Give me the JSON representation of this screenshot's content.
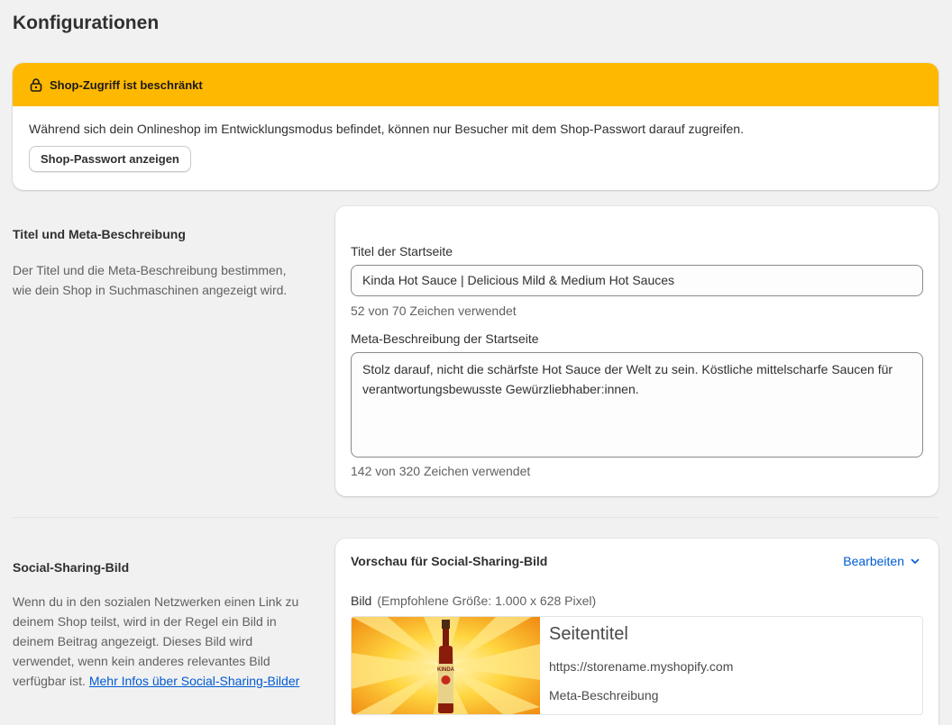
{
  "page": {
    "title": "Konfigurationen"
  },
  "banner": {
    "title": "Shop-Zugriff ist beschränkt",
    "text": "Während sich dein Onlineshop im Entwicklungsmodus befindet, können nur Besucher mit dem Shop-Passwort darauf zugreifen.",
    "button_label": "Shop-Passwort anzeigen",
    "color": "#ffb800"
  },
  "seo_section": {
    "title": "Titel und Meta-Beschreibung",
    "description": "Der Titel und die Meta-Beschreibung bestimmen, wie dein Shop in Suchmaschinen angezeigt wird.",
    "home_title": {
      "label": "Titel der Startseite",
      "value": "Kinda Hot Sauce | Delicious Mild & Medium Hot Sauces",
      "help": "52 von 70 Zeichen verwendet"
    },
    "home_meta": {
      "label": "Meta-Beschreibung der Startseite",
      "value": "Stolz darauf, nicht die schärfste Hot Sauce der Welt zu sein. Köstliche mittelscharfe Saucen für verantwortungsbewusste Gewürzliebhaber:innen.",
      "help": "142 von 320 Zeichen verwendet"
    }
  },
  "social_section": {
    "title": "Social-Sharing-Bild",
    "description": "Wenn du in den sozialen Netzwerken einen Link zu deinem Shop teilst, wird in der Regel ein Bild in deinem Beitrag angezeigt. Dieses Bild wird verwendet, wenn kein anderes relevantes Bild verfügbar ist.",
    "link_text": "Mehr Infos über Social-Sharing-Bilder",
    "card_title": "Vorschau für Social-Sharing-Bild",
    "edit_label": "Bearbeiten",
    "image_label": "Bild",
    "image_hint": "(Empfohlene Größe: 1.000 x 628 Pixel)",
    "preview": {
      "title": "Seitentitel",
      "url": "https://storename.myshopify.com",
      "description": "Meta-Beschreibung",
      "bottle_label": "KINDA"
    }
  },
  "colors": {
    "accent_link": "#005bd3",
    "banner": "#ffb800"
  }
}
